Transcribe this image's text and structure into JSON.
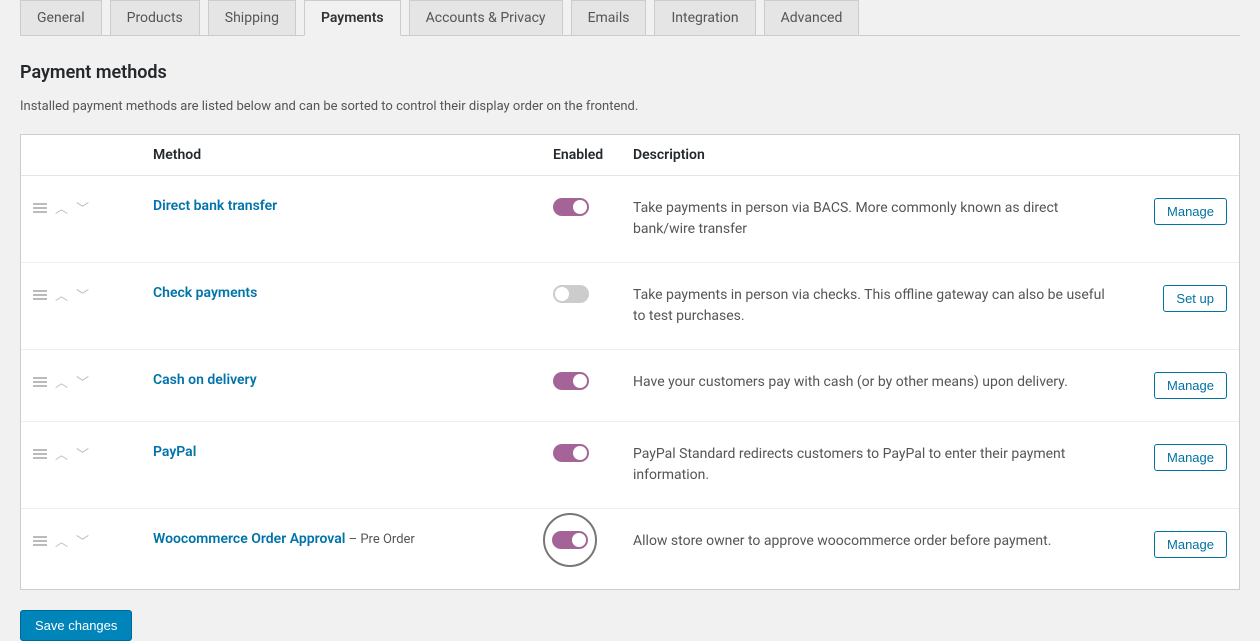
{
  "tabs": [
    {
      "label": "General",
      "active": false
    },
    {
      "label": "Products",
      "active": false
    },
    {
      "label": "Shipping",
      "active": false
    },
    {
      "label": "Payments",
      "active": true
    },
    {
      "label": "Accounts & Privacy",
      "active": false
    },
    {
      "label": "Emails",
      "active": false
    },
    {
      "label": "Integration",
      "active": false
    },
    {
      "label": "Advanced",
      "active": false
    }
  ],
  "section_title": "Payment methods",
  "intro": "Installed payment methods are listed below and can be sorted to control their display order on the frontend.",
  "headers": {
    "method": "Method",
    "enabled": "Enabled",
    "description": "Description"
  },
  "methods": [
    {
      "name": "Direct bank transfer",
      "suffix": "",
      "enabled": true,
      "highlight": false,
      "description": "Take payments in person via BACS. More commonly known as direct bank/wire transfer",
      "action": "Manage"
    },
    {
      "name": "Check payments",
      "suffix": "",
      "enabled": false,
      "highlight": false,
      "description": "Take payments in person via checks. This offline gateway can also be useful to test purchases.",
      "action": "Set up"
    },
    {
      "name": "Cash on delivery",
      "suffix": "",
      "enabled": true,
      "highlight": false,
      "description": "Have your customers pay with cash (or by other means) upon delivery.",
      "action": "Manage"
    },
    {
      "name": "PayPal",
      "suffix": "",
      "enabled": true,
      "highlight": false,
      "description": "PayPal Standard redirects customers to PayPal to enter their payment information.",
      "action": "Manage"
    },
    {
      "name": "Woocommerce Order Approval",
      "suffix": " – Pre Order",
      "enabled": true,
      "highlight": true,
      "description": "Allow store owner to approve woocommerce order before payment.",
      "action": "Manage"
    }
  ],
  "save_label": "Save changes"
}
